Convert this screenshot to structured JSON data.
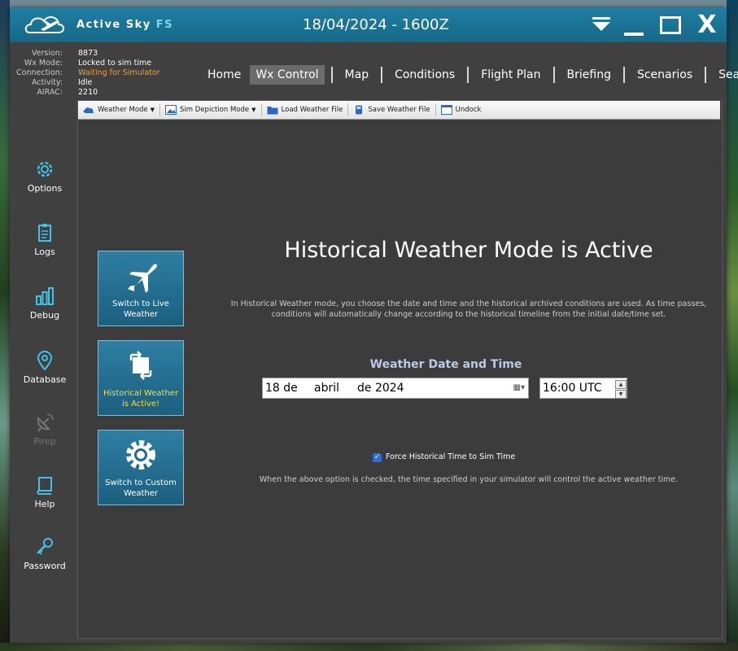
{
  "app": {
    "brand_main": "Active Sky ",
    "brand_accent": "FS",
    "title_time": "18/04/2024 - 1600Z",
    "close_glyph": "X"
  },
  "status": {
    "rows": [
      {
        "label": "Version:",
        "value": "8873"
      },
      {
        "label": "Wx Mode:",
        "value": "Locked to sim time"
      },
      {
        "label": "Connection:",
        "value": "Waiting for Simulator"
      },
      {
        "label": "Activity:",
        "value": "Idle"
      },
      {
        "label": "AIRAC:",
        "value": "2210"
      }
    ],
    "warning_color": "#f0a030"
  },
  "nav": {
    "items": [
      "Home",
      "Wx Control",
      "Map",
      "Conditions",
      "Flight Plan",
      "Briefing",
      "Scenarios",
      "Search"
    ],
    "active": "Wx Control"
  },
  "sidebar": {
    "items": [
      {
        "label": "Options",
        "icon": "gear-icon"
      },
      {
        "label": "Logs",
        "icon": "clipboard-icon"
      },
      {
        "label": "Debug",
        "icon": "bar-chart-icon"
      },
      {
        "label": "Database",
        "icon": "map-pin-icon"
      },
      {
        "label": "Pirep",
        "icon": "satellite-dish-icon",
        "disabled": true
      },
      {
        "label": "Help",
        "icon": "book-icon"
      },
      {
        "label": "Password",
        "icon": "key-icon"
      }
    ]
  },
  "toolbar": {
    "weather_mode": "Weather Mode",
    "sim_depiction": "Sim Depiction Mode",
    "load_file": "Load Weather File",
    "save_file": "Save Weather File",
    "undock": "Undock"
  },
  "modes": {
    "live": "Switch to Live Weather",
    "historical": "Historical Weather is Active!",
    "custom": "Switch to Custom Weather",
    "active_color": "#f5e03a"
  },
  "main": {
    "heading": "Historical Weather Mode is Active",
    "description": "In Historical Weather mode, you choose the date and time and the historical archived conditions are used.  As time passes, conditions will automatically change according to the historical timeline from the initial date/time set.",
    "datetime_title": "Weather Date and Time",
    "date_day": "18 de",
    "date_month": "abril",
    "date_year": "de 2024",
    "time_value": "16:00 UTC",
    "force_label": "Force Historical Time to Sim Time",
    "force_checked": true,
    "note": "When the above option is checked, the time specified in your simulator will control the active weather time."
  },
  "colors": {
    "titlebar": "#1f7ea3",
    "panel": "#404040",
    "accent": "#2d7fa3"
  }
}
